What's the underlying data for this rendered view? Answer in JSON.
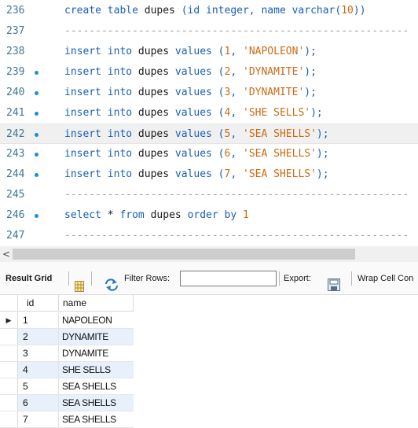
{
  "editor": {
    "lines": [
      {
        "num": "236",
        "marked": false,
        "current": false,
        "tokens": [
          {
            "t": "create table",
            "c": "kw"
          },
          {
            "t": " dupes ",
            "c": "plain"
          },
          {
            "t": "(id integer, name varchar(",
            "c": "kw"
          },
          {
            "t": "10",
            "c": "num"
          },
          {
            "t": "))",
            "c": "kw"
          }
        ]
      },
      {
        "num": "237",
        "marked": false,
        "current": false,
        "tokens": [
          {
            "t": "--------------------------------------------------------",
            "c": "dash"
          }
        ]
      },
      {
        "num": "238",
        "marked": false,
        "current": false,
        "tokens": [
          {
            "t": "insert into",
            "c": "kw"
          },
          {
            "t": " dupes ",
            "c": "plain"
          },
          {
            "t": "values (",
            "c": "kw"
          },
          {
            "t": "1",
            "c": "num"
          },
          {
            "t": ", ",
            "c": "kw"
          },
          {
            "t": "'NAPOLEON'",
            "c": "str"
          },
          {
            "t": ");",
            "c": "kw"
          }
        ]
      },
      {
        "num": "239",
        "marked": true,
        "current": false,
        "tokens": [
          {
            "t": "insert into",
            "c": "kw"
          },
          {
            "t": " dupes ",
            "c": "plain"
          },
          {
            "t": "values (",
            "c": "kw"
          },
          {
            "t": "2",
            "c": "num"
          },
          {
            "t": ", ",
            "c": "kw"
          },
          {
            "t": "'DYNAMITE'",
            "c": "str"
          },
          {
            "t": ");",
            "c": "kw"
          }
        ]
      },
      {
        "num": "240",
        "marked": true,
        "current": false,
        "tokens": [
          {
            "t": "insert into",
            "c": "kw"
          },
          {
            "t": " dupes ",
            "c": "plain"
          },
          {
            "t": "values (",
            "c": "kw"
          },
          {
            "t": "3",
            "c": "num"
          },
          {
            "t": ", ",
            "c": "kw"
          },
          {
            "t": "'DYNAMITE'",
            "c": "str"
          },
          {
            "t": ");",
            "c": "kw"
          }
        ]
      },
      {
        "num": "241",
        "marked": true,
        "current": false,
        "tokens": [
          {
            "t": "insert into",
            "c": "kw"
          },
          {
            "t": " dupes ",
            "c": "plain"
          },
          {
            "t": "values (",
            "c": "kw"
          },
          {
            "t": "4",
            "c": "num"
          },
          {
            "t": ", ",
            "c": "kw"
          },
          {
            "t": "'SHE SELLS'",
            "c": "str"
          },
          {
            "t": ");",
            "c": "kw"
          }
        ]
      },
      {
        "num": "242",
        "marked": true,
        "current": true,
        "tokens": [
          {
            "t": "insert into",
            "c": "kw"
          },
          {
            "t": " dupes ",
            "c": "plain"
          },
          {
            "t": "values (",
            "c": "kw"
          },
          {
            "t": "5",
            "c": "num"
          },
          {
            "t": ", ",
            "c": "kw"
          },
          {
            "t": "'SEA SHELLS'",
            "c": "str"
          },
          {
            "t": ");",
            "c": "kw"
          }
        ]
      },
      {
        "num": "243",
        "marked": true,
        "current": false,
        "tokens": [
          {
            "t": "insert into",
            "c": "kw"
          },
          {
            "t": " dupes ",
            "c": "plain"
          },
          {
            "t": "values (",
            "c": "kw"
          },
          {
            "t": "6",
            "c": "num"
          },
          {
            "t": ", ",
            "c": "kw"
          },
          {
            "t": "'SEA SHELLS'",
            "c": "str"
          },
          {
            "t": ");",
            "c": "kw"
          }
        ]
      },
      {
        "num": "244",
        "marked": true,
        "current": false,
        "tokens": [
          {
            "t": "insert into",
            "c": "kw"
          },
          {
            "t": " dupes ",
            "c": "plain"
          },
          {
            "t": "values (",
            "c": "kw"
          },
          {
            "t": "7",
            "c": "num"
          },
          {
            "t": ", ",
            "c": "kw"
          },
          {
            "t": "'SEA SHELLS'",
            "c": "str"
          },
          {
            "t": ");",
            "c": "kw"
          }
        ]
      },
      {
        "num": "245",
        "marked": false,
        "current": false,
        "tokens": [
          {
            "t": "--------------------------------------------------------",
            "c": "dash"
          }
        ]
      },
      {
        "num": "246",
        "marked": true,
        "current": false,
        "tokens": [
          {
            "t": "select",
            "c": "kw"
          },
          {
            "t": " * ",
            "c": "plain"
          },
          {
            "t": "from",
            "c": "kw"
          },
          {
            "t": " dupes ",
            "c": "plain"
          },
          {
            "t": "order by",
            "c": "kw"
          },
          {
            "t": " ",
            "c": "plain"
          },
          {
            "t": "1",
            "c": "num"
          }
        ]
      },
      {
        "num": "247",
        "marked": false,
        "current": false,
        "tokens": [
          {
            "t": "--------------------------------------------------------",
            "c": "dash"
          }
        ]
      }
    ]
  },
  "scrollbar": {
    "left_arrow": "<"
  },
  "toolbar": {
    "title": "Result Grid",
    "filter_label": "Filter Rows:",
    "filter_value": "",
    "export_label": "Export:",
    "wrap_label": "Wrap Cell Con"
  },
  "icons": {
    "grid_icon": "grid-icon",
    "refresh_icon": "refresh-icon",
    "export_icon": "export-icon",
    "row_marker_icon": "current-row-marker-icon"
  },
  "colors": {
    "keyword": "#1a5fb4",
    "string_literal": "#cc6a12",
    "line_number": "#3d7893",
    "statement_marker": "#1e8fd6",
    "alt_row": "#e8f0fb"
  },
  "grid": {
    "columns": [
      "id",
      "name"
    ],
    "current_row_marker": "▶",
    "rows": [
      {
        "id": "1",
        "name": "NAPOLEON"
      },
      {
        "id": "2",
        "name": "DYNAMITE"
      },
      {
        "id": "3",
        "name": "DYNAMITE"
      },
      {
        "id": "4",
        "name": "SHE SELLS"
      },
      {
        "id": "5",
        "name": "SEA SHELLS"
      },
      {
        "id": "6",
        "name": "SEA SHELLS"
      },
      {
        "id": "7",
        "name": "SEA SHELLS"
      }
    ]
  }
}
